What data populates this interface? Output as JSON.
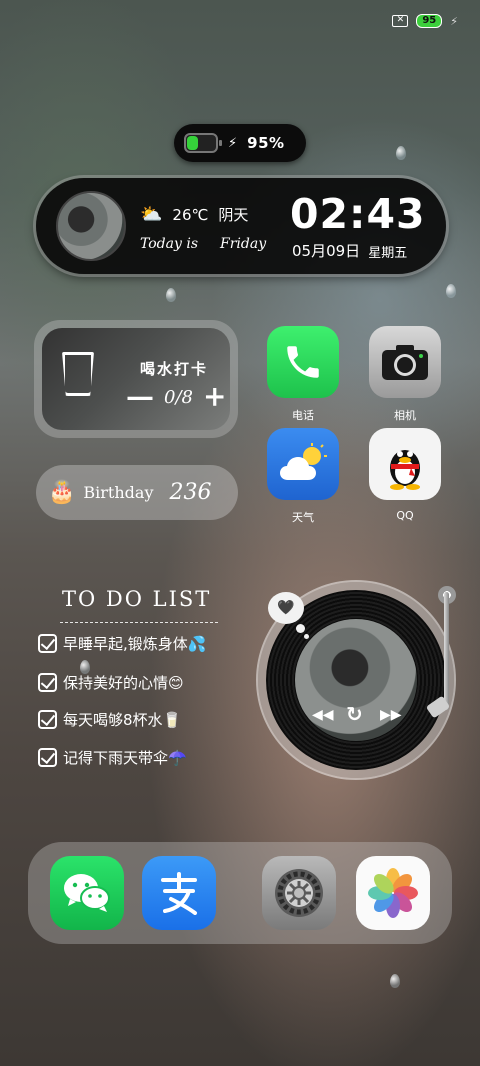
{
  "status_bar": {
    "sim": "✕",
    "battery_level": "95"
  },
  "battery_widget": {
    "percent_text": "95%",
    "fill_fraction": 0.95
  },
  "clock_widget": {
    "temperature": "26℃",
    "condition": "阴天",
    "today_label": "Today is",
    "weekday_en": "Friday",
    "time": "02:43",
    "date": "05月09日",
    "weekday_cn": "星期五"
  },
  "water_widget": {
    "title": "喝水打卡",
    "minus": "—",
    "count": "0/8",
    "plus": "+"
  },
  "birthday_widget": {
    "label": "Birthday",
    "days": "236"
  },
  "apps": {
    "phone": "电话",
    "camera": "相机",
    "weather": "天气",
    "qq": "QQ"
  },
  "todo": {
    "title": "TO DO LIST",
    "items": [
      "早睡早起,锻炼身体💦",
      "保持美好的心情😊",
      "每天喝够8杯水🥛",
      "记得下雨天带伞☂️"
    ]
  },
  "music": {
    "heart": "🖤",
    "prev": "◀◀",
    "play": "↻",
    "next": "▶▶"
  },
  "dock": {
    "icons": [
      "wechat-icon",
      "alipay-icon",
      "settings-icon",
      "photos-icon"
    ]
  },
  "colors": {
    "accent_green": "#35d23a",
    "phone_green": "#1ec24c",
    "wechat_green": "#12b54a",
    "alipay_blue": "#1a70e8"
  }
}
